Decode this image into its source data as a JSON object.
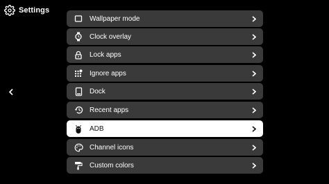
{
  "header": {
    "title": "Settings",
    "icon": "gear-icon"
  },
  "nav": {
    "back_icon": "chevron-left-icon"
  },
  "menu": {
    "items": [
      {
        "label": "Wallpaper mode",
        "icon": "wallpaper-icon",
        "selected": false
      },
      {
        "label": "Clock overlay",
        "icon": "watch-icon",
        "selected": false
      },
      {
        "label": "Lock apps",
        "icon": "lock-icon",
        "selected": false
      },
      {
        "label": "Ignore apps",
        "icon": "apps-grid-icon",
        "selected": false
      },
      {
        "label": "Dock",
        "icon": "dock-icon",
        "selected": false
      },
      {
        "label": "Recent apps",
        "icon": "history-icon",
        "selected": false
      },
      {
        "label": "ADB",
        "icon": "adb-icon",
        "selected": true
      },
      {
        "label": "Channel icons",
        "icon": "palette-icon",
        "selected": false
      },
      {
        "label": "Custom colors",
        "icon": "paint-roller-icon",
        "selected": false
      }
    ],
    "chevron_icon": "chevron-right-icon"
  },
  "colors": {
    "background": "#000000",
    "item_background": "#3a3a3a",
    "selected_background": "#ffffff",
    "text": "#ffffff",
    "selected_text": "#111111"
  }
}
